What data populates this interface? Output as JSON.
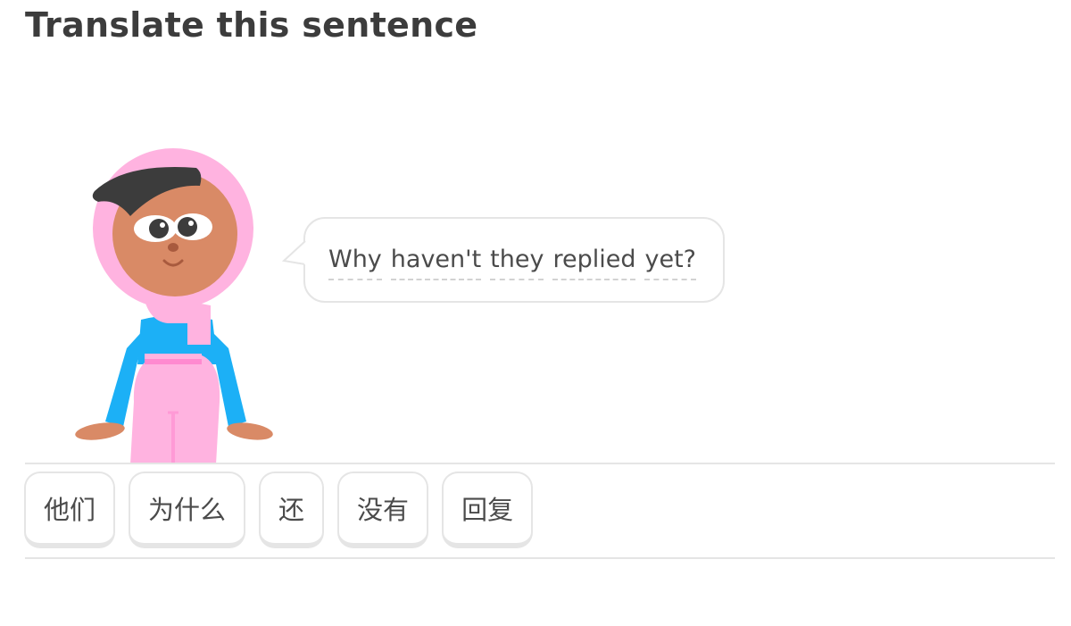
{
  "header": {
    "title": "Translate this sentence"
  },
  "prompt": {
    "character_icon": "woman-in-pink-hijab-character",
    "sentence_words": [
      "Why",
      "haven't",
      "they",
      "replied",
      "yet?"
    ]
  },
  "word_bank": {
    "tiles": [
      "他们",
      "为什么",
      "还",
      "没有",
      "回复"
    ]
  },
  "colors": {
    "hijab": "#ffb3e0",
    "skin": "#d98a66",
    "hair": "#3c3c3c",
    "shirt": "#1cb0f6",
    "pants": "#ffb3e0",
    "border": "#e5e5e5",
    "text": "#4b4b4b"
  }
}
